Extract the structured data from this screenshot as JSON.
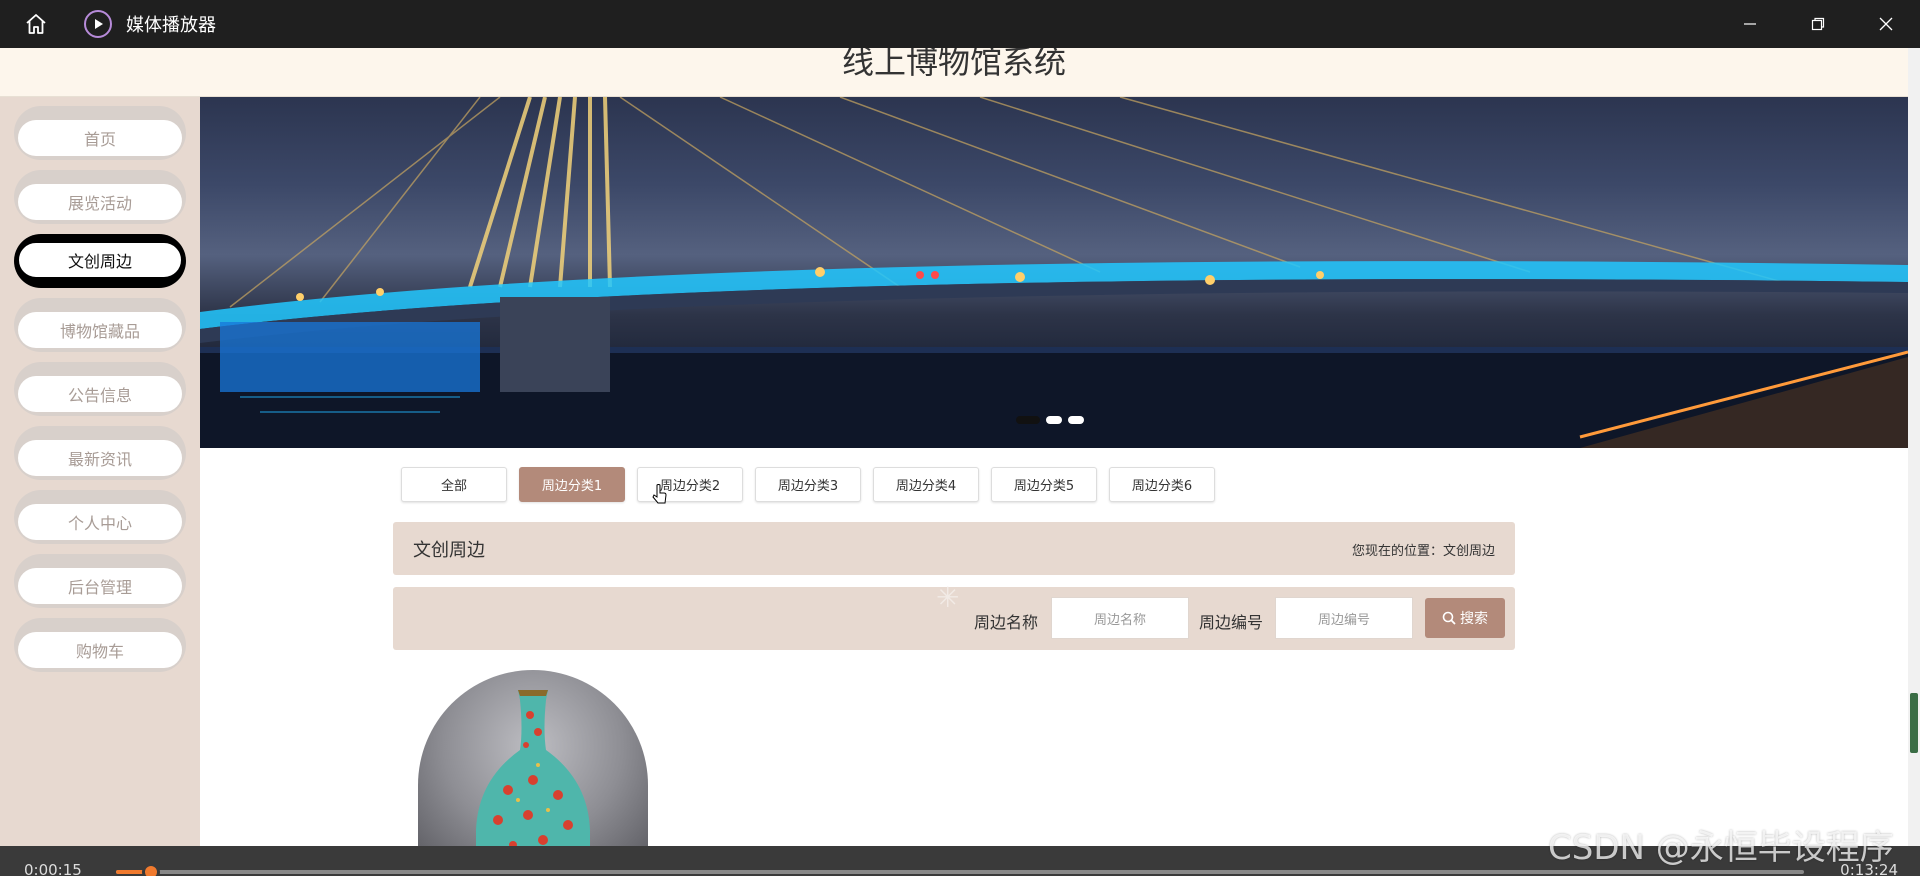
{
  "window": {
    "app_title": "媒体播放器",
    "home_icon": "home-icon",
    "app_icon": "play-circle-icon",
    "controls": [
      "minimize-icon",
      "restore-icon",
      "close-icon"
    ]
  },
  "site": {
    "title": "线上博物馆系统"
  },
  "sidebar": {
    "items": [
      {
        "label": "首页",
        "active": false
      },
      {
        "label": "展览活动",
        "active": false
      },
      {
        "label": "文创周边",
        "active": true
      },
      {
        "label": "博物馆藏品",
        "active": false
      },
      {
        "label": "公告信息",
        "active": false
      },
      {
        "label": "最新资讯",
        "active": false
      },
      {
        "label": "个人中心",
        "active": false
      },
      {
        "label": "后台管理",
        "active": false
      },
      {
        "label": "购物车",
        "active": false
      }
    ]
  },
  "banner": {
    "slide_count": 3,
    "active_slide": 1
  },
  "categories": {
    "tabs": [
      {
        "label": "全部",
        "active": false
      },
      {
        "label": "周边分类1",
        "active": true
      },
      {
        "label": "周边分类2",
        "active": false
      },
      {
        "label": "周边分类3",
        "active": false
      },
      {
        "label": "周边分类4",
        "active": false
      },
      {
        "label": "周边分类5",
        "active": false
      },
      {
        "label": "周边分类6",
        "active": false
      }
    ]
  },
  "section": {
    "title": "文创周边",
    "location_label": "您现在的位置：",
    "location_value": "文创周边"
  },
  "search": {
    "name_label": "周边名称",
    "name_placeholder": "周边名称",
    "code_label": "周边编号",
    "code_placeholder": "周边编号",
    "button_label": "搜索",
    "button_icon": "search-icon"
  },
  "player": {
    "current_time": "0:00:15",
    "total_time": "0:13:24",
    "progress": 0.019
  },
  "watermark": "CSDN @永恒毕设程序",
  "colors": {
    "accent": "#b38a7a",
    "panel": "#e7d9d0",
    "header_bg": "#fdf6ec",
    "progress": "#f07a2e"
  }
}
